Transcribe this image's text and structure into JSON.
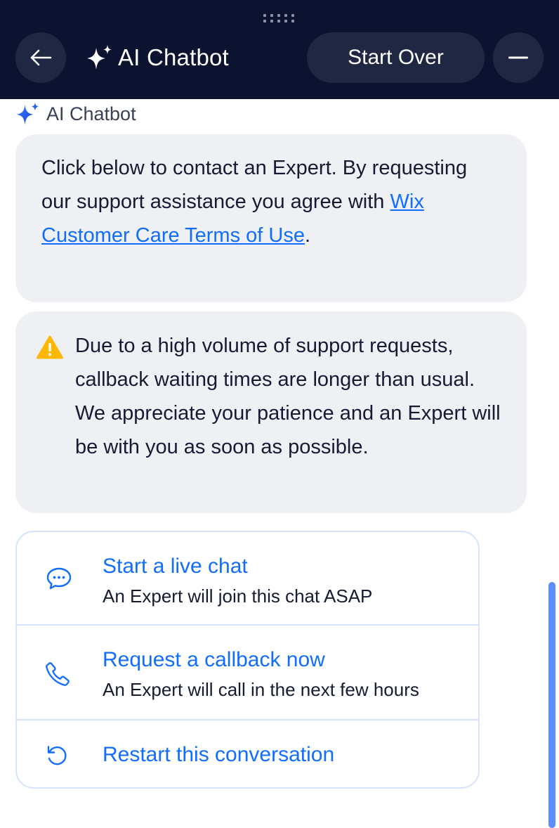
{
  "header": {
    "title": "AI Chatbot",
    "start_over_label": "Start Over",
    "back_icon": "arrow-left-icon",
    "minimize_icon": "minus-icon",
    "sparkle_icon": "sparkle-icon",
    "background_color": "#0c1330"
  },
  "message": {
    "sender": "AI Chatbot",
    "bubble1": {
      "text_before": "Click below to contact an Expert. By requesting our support assistance you agree with ",
      "link_text": "Wix Customer Care Terms of Use",
      "text_after": "."
    },
    "bubble2": {
      "icon": "warning-icon",
      "text": "Due to a high volume of support requests, callback waiting times are longer than usual. We appreciate your patience and an Expert will be with you as soon as possible."
    }
  },
  "options": [
    {
      "icon": "chat-bubble-icon",
      "title": "Start a live chat",
      "subtitle": "An Expert will join this chat ASAP"
    },
    {
      "icon": "phone-icon",
      "title": "Request a callback now",
      "subtitle": "An Expert will call in the next few hours"
    },
    {
      "icon": "restart-icon",
      "title": "Restart this conversation"
    }
  ],
  "colors": {
    "accent": "#116dff",
    "bubble_bg": "#eef0f4",
    "warning": "#ffb700",
    "text": "#161b33"
  }
}
